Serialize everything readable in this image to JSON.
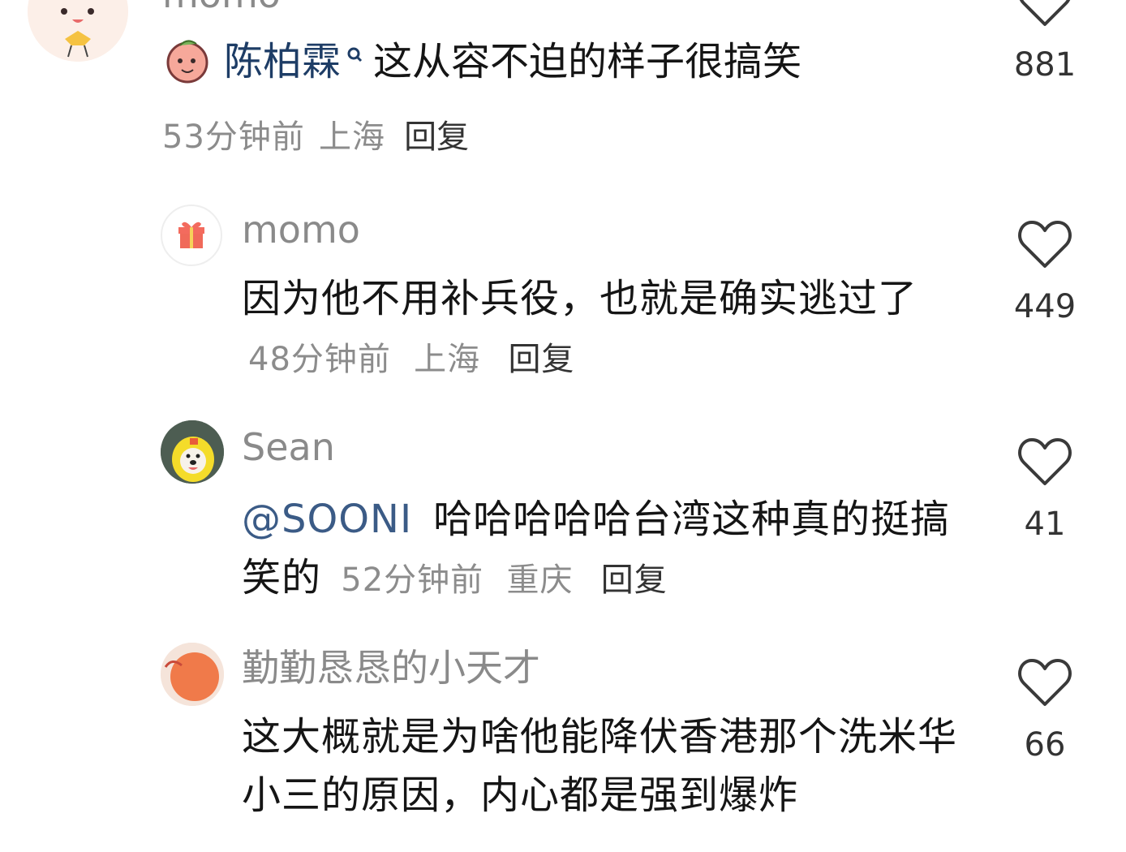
{
  "comments": [
    {
      "username": "momo",
      "reply_to_name": "陈柏霖",
      "text": "这从容不迫的样子很搞笑",
      "time": "53分钟前",
      "location": "上海",
      "reply_label": "回复",
      "likes": "881"
    },
    {
      "username": "momo",
      "text": "因为他不用补兵役，也就是确实逃过了",
      "time": "48分钟前",
      "location": "上海",
      "reply_label": "回复",
      "likes": "449"
    },
    {
      "username": "Sean",
      "mention": "@SOONI",
      "text": "哈哈哈哈哈台湾这种真的挺搞笑的",
      "time": "52分钟前",
      "location": "重庆",
      "reply_label": "回复",
      "likes": "41"
    },
    {
      "username": "勤勤恳恳的小天才",
      "text": "这大概就是为啥他能降伏香港那个洗米华小三的原因，内心都是强到爆炸",
      "likes": "66"
    }
  ],
  "icons": {
    "like": "heart-outline-icon",
    "search_badge": "search-icon",
    "gift": "gift-icon"
  },
  "colors": {
    "username": "#8a8a8a",
    "text": "#151515",
    "meta": "#8c8c8c",
    "mention": "#3b5b86"
  }
}
